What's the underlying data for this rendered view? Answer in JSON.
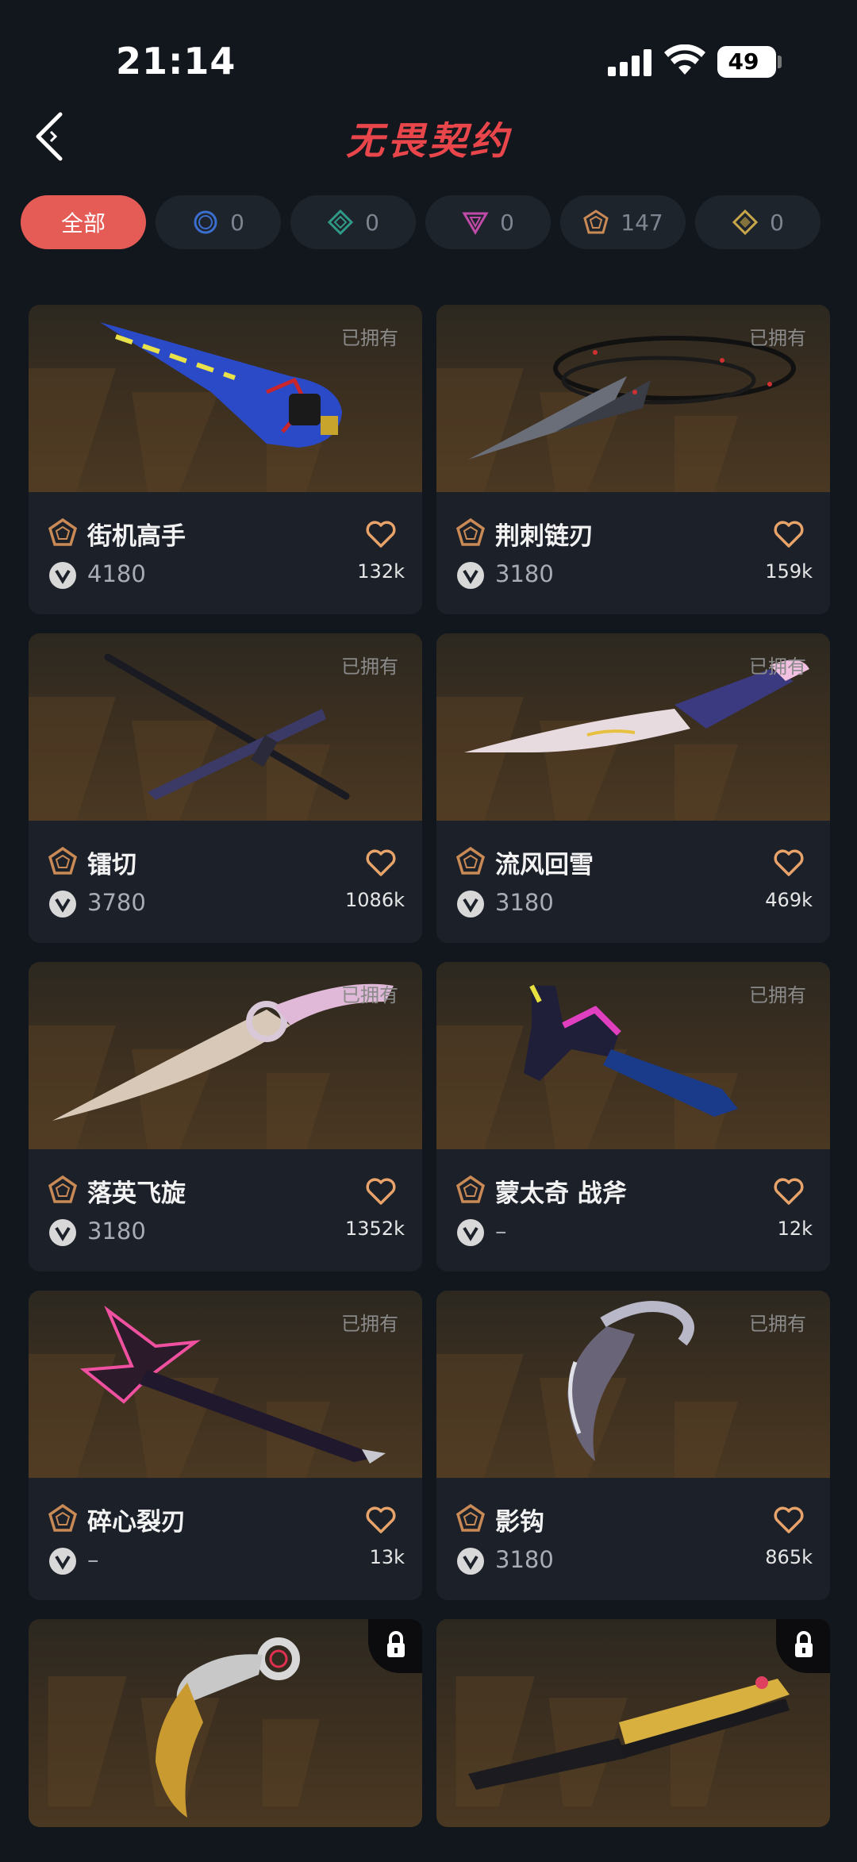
{
  "status": {
    "time": "21:14",
    "battery": "49",
    "battery_level": 0.49
  },
  "header": {
    "title": "无畏契约",
    "back_icon": "back-arrow-icon"
  },
  "filters": [
    {
      "label": "全部",
      "active": true
    },
    {
      "icon": "tier-circle-icon",
      "count": "0",
      "color": "#3a6fd0"
    },
    {
      "icon": "tier-diamond-icon",
      "count": "0",
      "color": "#2f9a86"
    },
    {
      "icon": "tier-triangle-icon",
      "count": "0",
      "color": "#c04aa8"
    },
    {
      "icon": "tier-pentagon-icon",
      "count": "147",
      "color": "#c98a56"
    },
    {
      "icon": "tier-rhombus-icon",
      "count": "0",
      "color": "#c8a64a"
    }
  ],
  "grid": {
    "owned_label": "已拥有",
    "items": [
      {
        "name": "街机高手",
        "price": "4180",
        "likes": "132k",
        "owned": true
      },
      {
        "name": "荆刺链刃",
        "price": "3180",
        "likes": "159k",
        "owned": true
      },
      {
        "name": "镭切",
        "price": "3780",
        "likes": "1086k",
        "owned": true
      },
      {
        "name": "流风回雪",
        "price": "3180",
        "likes": "469k",
        "owned": true
      },
      {
        "name": "落英飞旋",
        "price": "3180",
        "likes": "1352k",
        "owned": true
      },
      {
        "name": "蒙太奇 战斧",
        "price": "–",
        "likes": "12k",
        "owned": true
      },
      {
        "name": "碎心裂刃",
        "price": "–",
        "likes": "13k",
        "owned": true
      },
      {
        "name": "影钩",
        "price": "3180",
        "likes": "865k",
        "owned": true
      },
      {
        "name": "",
        "price": "",
        "likes": "",
        "owned": false,
        "locked": true
      },
      {
        "name": "",
        "price": "",
        "likes": "",
        "owned": false,
        "locked": true
      }
    ]
  },
  "colors": {
    "accent": "#e55b56",
    "tier": "#c98a56",
    "background": "#12161d",
    "card": "#1b2029"
  }
}
